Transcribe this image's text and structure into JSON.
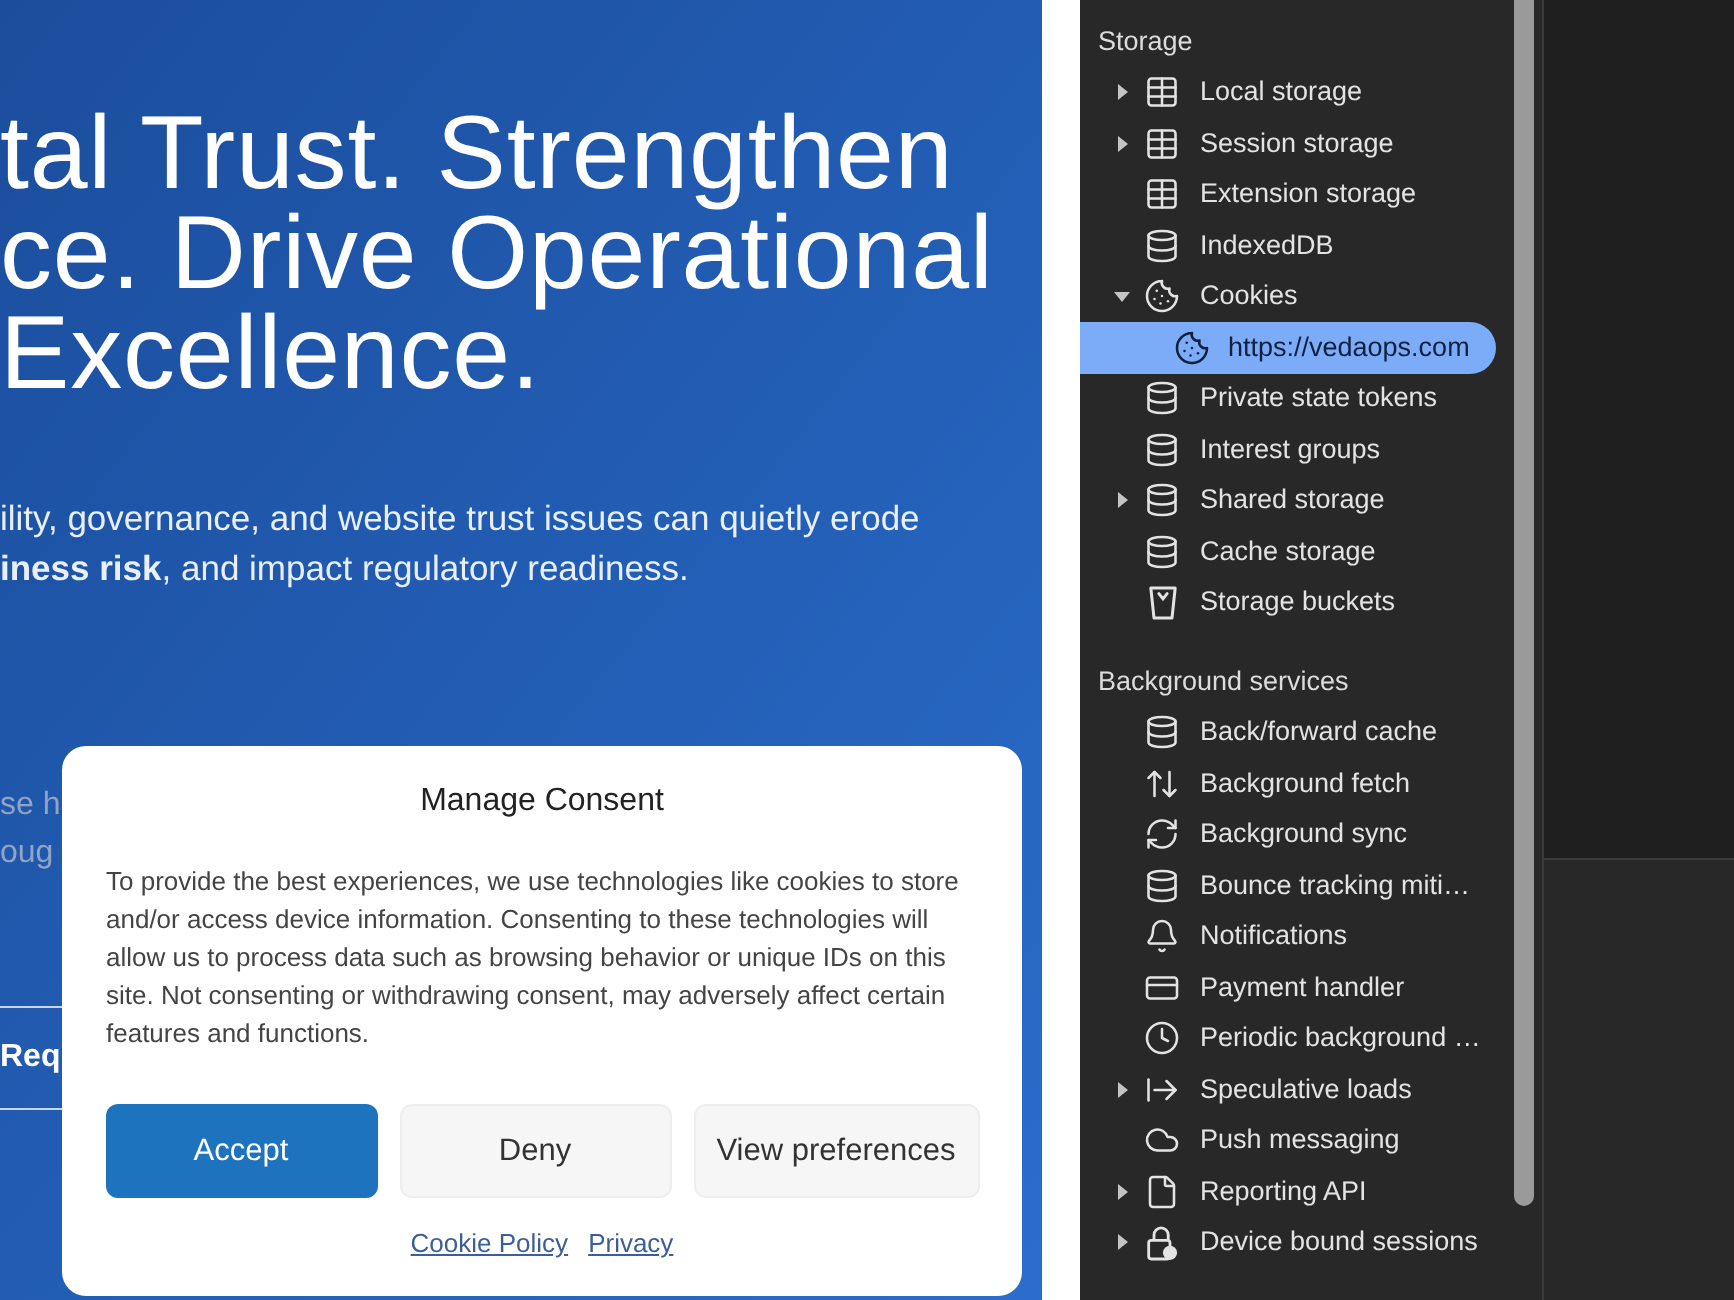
{
  "page": {
    "heading_lines": [
      "tal Trust. Strengthen",
      "ce. Drive Operational",
      "Excellence."
    ],
    "paragraph_lines": [
      "ility, governance, and website trust issues can quietly erode",
      "**iness risk**, and impact regulatory readiness."
    ],
    "faded_lines": [
      "se h",
      "oug"
    ],
    "button": {
      "label": "Req"
    }
  },
  "consent_dialog": {
    "title": "Manage Consent",
    "text": "To provide the best experiences, we use technologies like cookies to store and/or access device information. Consenting to these technologies will allow us to process data such as browsing behavior or unique IDs on this site. Not consenting or withdrawing consent, may adversely affect certain features and functions.",
    "buttons": [
      {
        "label": "Accept",
        "kind": "primary"
      },
      {
        "label": "Deny",
        "kind": "secondary"
      },
      {
        "label": "View preferences",
        "kind": "secondary"
      }
    ],
    "links": [
      "Cookie Policy",
      "Privacy"
    ]
  },
  "devtools": {
    "sections": [
      {
        "title": "Storage",
        "items": [
          {
            "label": "Local storage",
            "kind": "table",
            "expanded": false,
            "selected": false
          },
          {
            "label": "Session storage",
            "kind": "table",
            "expanded": false,
            "selected": false
          },
          {
            "label": "Extension storage",
            "kind": "table",
            "selected": false
          },
          {
            "label": "IndexedDB",
            "kind": "database",
            "selected": false
          },
          {
            "label": "Cookies",
            "kind": "cookie",
            "expanded": true,
            "selected": false,
            "children": [
              {
                "label": "https://vedaops.com",
                "kind": "cookie",
                "selected": true
              }
            ]
          },
          {
            "label": "Private state tokens",
            "kind": "database",
            "selected": false
          },
          {
            "label": "Interest groups",
            "kind": "database",
            "selected": false
          },
          {
            "label": "Shared storage",
            "kind": "database",
            "expanded": false,
            "selected": false
          },
          {
            "label": "Cache storage",
            "kind": "database",
            "selected": false
          },
          {
            "label": "Storage buckets",
            "kind": "bucket",
            "selected": false
          }
        ]
      },
      {
        "title": "Background services",
        "items": [
          {
            "label": "Back/forward cache",
            "kind": "database",
            "selected": false
          },
          {
            "label": "Background fetch",
            "kind": "transfer",
            "selected": false
          },
          {
            "label": "Background sync",
            "kind": "sync",
            "selected": false
          },
          {
            "label": "Bounce tracking miti…",
            "kind": "database",
            "selected": false
          },
          {
            "label": "Notifications",
            "kind": "bell",
            "selected": false
          },
          {
            "label": "Payment handler",
            "kind": "card",
            "selected": false
          },
          {
            "label": "Periodic background …",
            "kind": "clock",
            "selected": false
          },
          {
            "label": "Speculative loads",
            "kind": "speculative",
            "expanded": false,
            "selected": false
          },
          {
            "label": "Push messaging",
            "kind": "cloud",
            "selected": false
          },
          {
            "label": "Reporting API",
            "kind": "file",
            "expanded": false,
            "selected": false
          },
          {
            "label": "Device bound sessions",
            "kind": "lock",
            "expanded": false,
            "selected": false
          }
        ]
      }
    ]
  }
}
